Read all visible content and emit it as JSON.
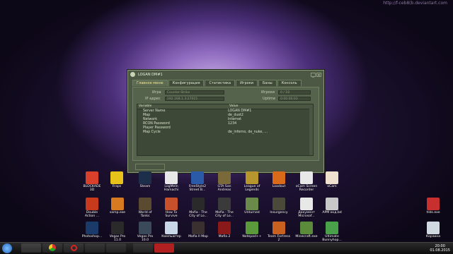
{
  "watermark": "http://f-ceb8(b.deviantart.com",
  "dialog": {
    "title": "LOGAN DM#1",
    "tabs": [
      "Главное меню",
      "Конфигурация",
      "Статистика",
      "Игроки",
      "Баны",
      "Консоль"
    ],
    "game_label": "Игра",
    "game_value": "Counter-Strike",
    "ip_label": "IP адрес",
    "ip_value": "192.168.1.3:27015",
    "players_label": "Игроки",
    "players_value": "0 / 18",
    "uptime_label": "Uptime",
    "uptime_value": "0:00:00:03",
    "table": {
      "headers": [
        "Variable",
        "Value"
      ],
      "rows": [
        [
          "Server Name",
          "LOGAN DM#1"
        ],
        [
          "Map",
          "de_dust2"
        ],
        [
          "Network",
          "Internet"
        ],
        [
          "RCON Password",
          "1234"
        ],
        [
          "Player Password",
          ""
        ],
        [
          "Map Cycle",
          "de_inferno, de_nuke, ..."
        ]
      ]
    }
  },
  "icons": [
    {
      "label": "BLOCKADE 3D",
      "color": "#d8402c"
    },
    {
      "label": "Fraps",
      "color": "#e6c21a"
    },
    {
      "label": "Steam",
      "color": "#1c2e4a"
    },
    {
      "label": "LogMeIn Hamachi",
      "color": "#e8e8e8"
    },
    {
      "label": "FreeStyle2 Street B...",
      "color": "#2a5aa8"
    },
    {
      "label": "GTA San Andreas",
      "color": "#7a6a3a"
    },
    {
      "label": "League of Legends",
      "color": "#b8962e"
    },
    {
      "label": "Loadout",
      "color": "#d96a1a"
    },
    {
      "label": "oCam Screen Recorder",
      "color": "#e8e8e8"
    },
    {
      "label": "oCam",
      "color": "#f0e0d0"
    },
    {
      "label": "Double Action ...",
      "color": "#c83a1c"
    },
    {
      "label": "samp.exe",
      "color": "#d87a20"
    },
    {
      "label": "World of Tanks",
      "color": "#5a4a30"
    },
    {
      "label": "How To Survive",
      "color": "#c8502a"
    },
    {
      "label": "Mafia - The City of Lo...",
      "color": "#2a2a2a"
    },
    {
      "label": "Mafia - The City of Lo...",
      "color": "#3a3a3a"
    },
    {
      "label": "Unturned",
      "color": "#6a8a4a"
    },
    {
      "label": "Insurgency",
      "color": "#4a4a3a"
    },
    {
      "label": "Документ Microsof...",
      "color": "#e8e8e8"
    },
    {
      "label": "АРМ ккд.bd",
      "color": "#c8c8c8"
    },
    {
      "label": "hlds.exe",
      "color": "#c83030"
    },
    {
      "label": "Photoshop...",
      "color": "#1a3a6a"
    },
    {
      "label": "Vegas Pro 11.0",
      "color": "#2a2a2a"
    },
    {
      "label": "Vegas Pro 10.0",
      "color": "#3a4a5a"
    },
    {
      "label": "Компьютер",
      "color": "#c8d8e8"
    },
    {
      "label": "Mafia II Map",
      "color": "#3a3030"
    },
    {
      "label": "Mafia 2",
      "color": "#8a1a1a"
    },
    {
      "label": "Notepad++",
      "color": "#5a9a3a"
    },
    {
      "label": "Team Fortress 2",
      "color": "#c86020"
    },
    {
      "label": "Minecraft.exe",
      "color": "#5a8a3a"
    },
    {
      "label": "Ultimate Bunnyhop...",
      "color": "#4aa04a"
    },
    {
      "label": "Корзина",
      "color": "#d0d8e0"
    }
  ],
  "taskbar": {
    "time": "20:00",
    "date": "01.08.2015"
  }
}
